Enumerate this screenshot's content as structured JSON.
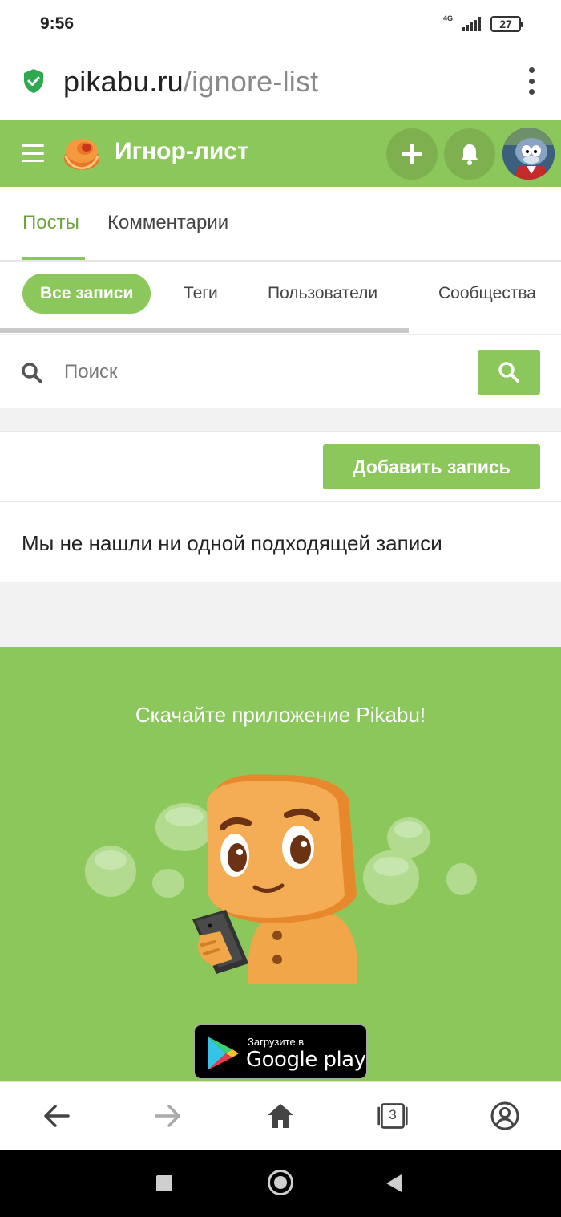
{
  "status_bar": {
    "time": "9:56",
    "network": "4G",
    "battery": "27"
  },
  "browser": {
    "url_domain": "pikabu.ru",
    "url_path": "/ignore-list"
  },
  "header": {
    "title": "Игнор-лист",
    "accent_color": "#8bc75a"
  },
  "tabs": [
    {
      "label": "Посты",
      "active": true
    },
    {
      "label": "Комментарии",
      "active": false
    }
  ],
  "filters": [
    {
      "label": "Все записи",
      "active": true
    },
    {
      "label": "Теги",
      "active": false
    },
    {
      "label": "Пользователи",
      "active": false
    },
    {
      "label": "Сообщества",
      "active": false
    }
  ],
  "search": {
    "placeholder": "Поиск",
    "value": ""
  },
  "actions": {
    "add_record_label": "Добавить запись"
  },
  "empty_state": {
    "message": "Мы не нашли ни одной подходящей записи"
  },
  "promo": {
    "title": "Скачайте приложение Pikabu!",
    "badge_small": "Загрузите в",
    "badge_big": "Google play"
  },
  "browser_nav": {
    "tabs_count": "3"
  }
}
